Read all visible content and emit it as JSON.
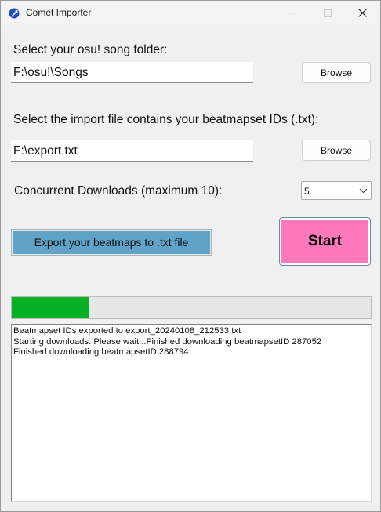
{
  "window": {
    "title": "Comet Importer"
  },
  "song_folder": {
    "label": "Select your osu! song folder:",
    "value": "F:\\osu!\\Songs",
    "browse_label": "Browse"
  },
  "import_file": {
    "label": "Select the import file contains your beatmapset IDs (.txt):",
    "value": "F:\\export.txt",
    "browse_label": "Browse"
  },
  "concurrent": {
    "label": "Concurrent Downloads (maximum 10):",
    "selected": "5"
  },
  "actions": {
    "export_label": "Export your beatmaps to .txt file",
    "start_label": "Start"
  },
  "progress": {
    "fraction": 0.217
  },
  "log": {
    "lines": [
      "Beatmapset IDs exported to export_20240108_212533.txt",
      "Starting downloads. Please wait...Finished downloading beatmapsetID 287052",
      "Finished downloading beatmapsetID 288794"
    ]
  },
  "colors": {
    "export_button": "#5fa3c9",
    "start_button": "#ff78bd",
    "progress_fill": "#06b025"
  },
  "icons": {
    "app": "comet-icon",
    "minimize": "minimize-icon",
    "maximize": "maximize-icon",
    "close": "close-icon",
    "dropdown": "chevron-down-icon"
  }
}
